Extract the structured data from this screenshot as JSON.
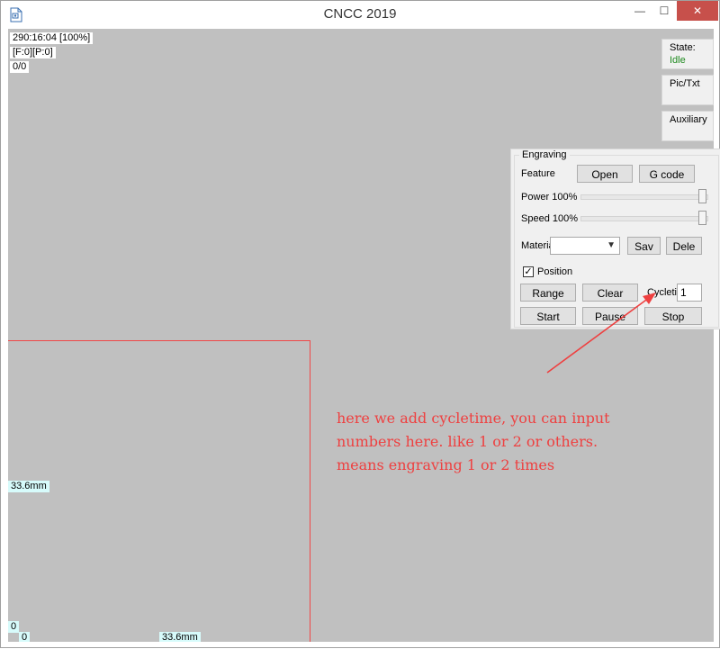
{
  "window": {
    "title": "CNCC 2019",
    "min_label": "—",
    "max_label": "☐",
    "close_label": "✕"
  },
  "canvas": {
    "status_time": "290:16:04 [100%]",
    "status_fp": "[F:0][P:0]",
    "status_count": "0/0",
    "dim_vertical": "33.6mm",
    "dim_horizontal": "33.6mm",
    "origin_y": "0",
    "origin_x": "0"
  },
  "side": {
    "state_label": "State:",
    "state_value": "Idle",
    "pictxt_label": "Pic/Txt",
    "auxiliary_label": "Auxiliary"
  },
  "engraving": {
    "group_title": "Engraving",
    "feature_label": "Feature",
    "open_button": "Open",
    "gcode_button": "G code",
    "power_label": "Power 100%",
    "speed_label": "Speed 100%",
    "material_label": "Material",
    "save_button": "Sav",
    "delete_button": "Dele",
    "position_label": "Position",
    "position_check": "✓",
    "range_button": "Range",
    "clear_button": "Clear",
    "cycletime_label": "Cycletime",
    "cycletime_value": "1",
    "start_button": "Start",
    "pause_button": "Pause",
    "stop_button": "Stop",
    "power_level": 1.0,
    "speed_level": 1.0
  },
  "annotation": {
    "line1": "here we add cycletime, you can input",
    "line2": "numbers here. like 1 or 2 or others.",
    "line3": "means engraving 1 or 2 times",
    "color": "#ee4040"
  }
}
